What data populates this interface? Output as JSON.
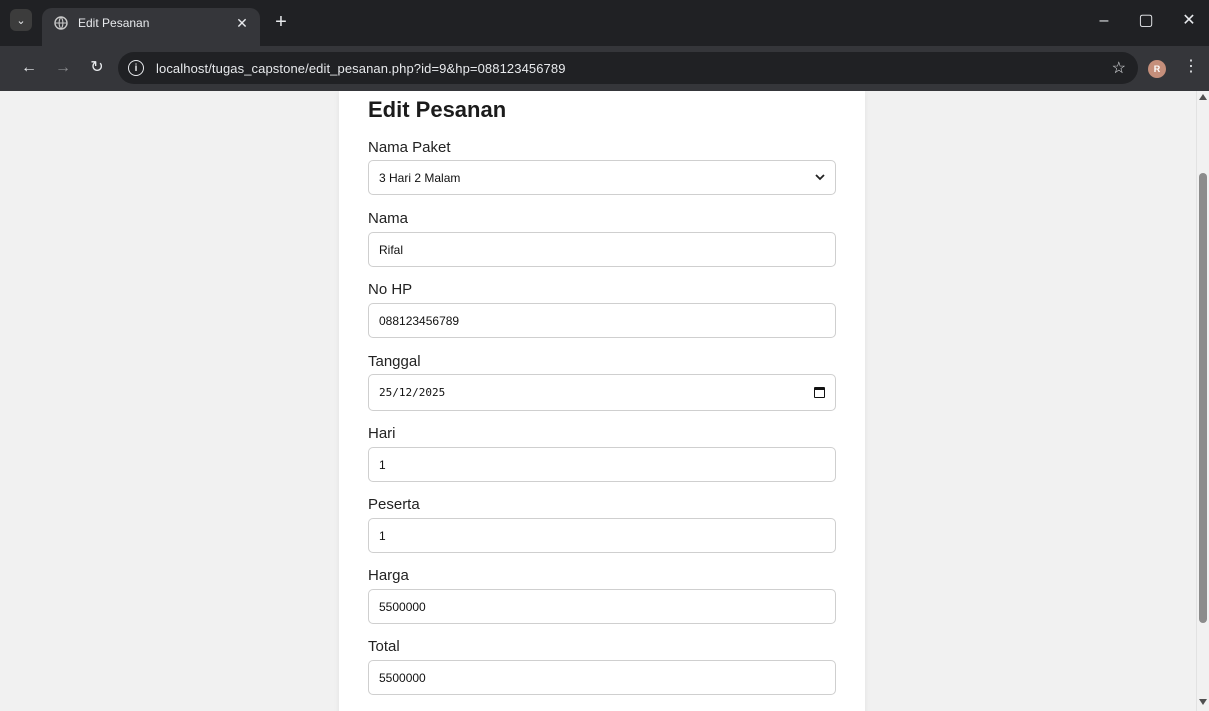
{
  "browser": {
    "tab_title": "Edit Pesanan",
    "url": "localhost/tugas_capstone/edit_pesanan.php?id=9&hp=088123456789",
    "avatar_initial": "R",
    "icons": {
      "tab_menu": "chevron-down-icon",
      "favicon": "globe-icon",
      "close": "close-icon",
      "new_tab": "plus-icon",
      "back": "back-arrow-icon",
      "forward": "forward-arrow-icon",
      "reload": "reload-icon",
      "info": "info-icon",
      "bookmark": "star-icon",
      "menu": "kebab-menu-icon"
    }
  },
  "form": {
    "title": "Edit Pesanan",
    "nama_paket": {
      "label": "Nama Paket",
      "value": "3 Hari 2 Malam"
    },
    "nama": {
      "label": "Nama",
      "value": "Rifal"
    },
    "no_hp": {
      "label": "No HP",
      "value": "088123456789"
    },
    "tanggal": {
      "label": "Tanggal",
      "value": "25/12/2025"
    },
    "hari": {
      "label": "Hari",
      "value": "1"
    },
    "peserta": {
      "label": "Peserta",
      "value": "1"
    },
    "harga": {
      "label": "Harga",
      "value": "5500000"
    },
    "total": {
      "label": "Total",
      "value": "5500000"
    }
  },
  "colors": {
    "tabstrip": "#202124",
    "toolbar": "#35363a",
    "page_background": "#f1f1f1",
    "card": "#ffffff",
    "avatar": "#c58f7b"
  }
}
